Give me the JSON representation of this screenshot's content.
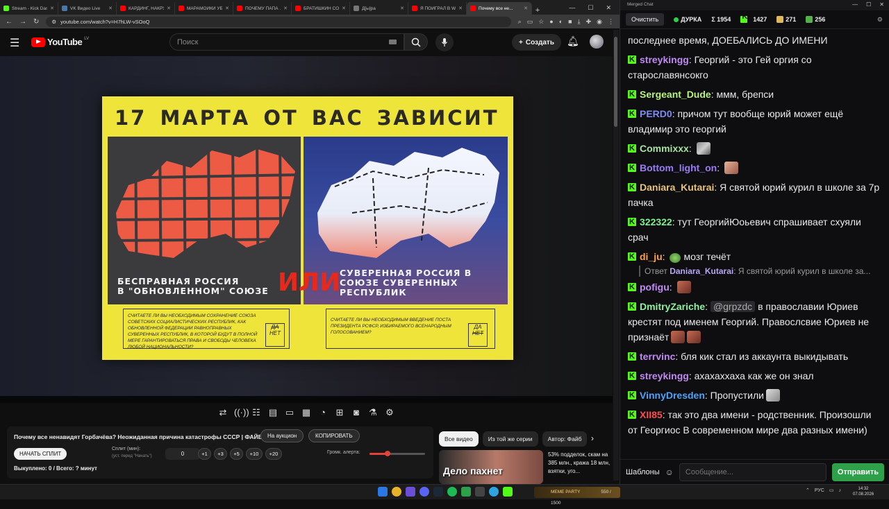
{
  "browser": {
    "tabs": [
      {
        "label": "Stream - Kick Dashboard",
        "color": "#53fc18",
        "active": false
      },
      {
        "label": "VK Видео Live",
        "color": "#4a76a8",
        "active": false
      },
      {
        "label": "КАРДИНГ, НАКРУ...",
        "color": "#ff0000",
        "active": false
      },
      {
        "label": "МАРАМОЙКИ УБ...",
        "color": "#ff0000",
        "active": false
      },
      {
        "label": "ПОЧЕМУ ПАПА ...",
        "color": "#ff0000",
        "active": false
      },
      {
        "label": "БРАТИШКИН СО...",
        "color": "#ff0000",
        "active": false
      },
      {
        "label": "Д[ы]ра",
        "color": "#777777",
        "active": false
      },
      {
        "label": "Я ПОИГРАЛ В WA...",
        "color": "#ff0000",
        "active": false
      },
      {
        "label": "Почему все не...",
        "color": "#ff0000",
        "active": true
      }
    ],
    "url": "youtube.com/watch?v=H7hLW-vSOoQ"
  },
  "youtube": {
    "logo_text": "YouTube",
    "country": "LV",
    "search_placeholder": "Поиск",
    "create_label": "Создать"
  },
  "poster": {
    "title": "17 МАРТА ОТ ВАС ЗАВИСИТ",
    "left_caption_1": "БЕСПРАВНАЯ РОССИЯ",
    "left_caption_2": "В \"ОБНОВЛЕННОМ\" СОЮЗЕ",
    "ili": "ИЛИ",
    "right_caption_1": "СУВЕРЕННАЯ РОССИЯ В",
    "right_caption_2": "СОЮЗЕ СУВЕРЕННЫХ",
    "right_caption_3": "РЕСПУБЛИК",
    "ballot_left": "СЧИТАЕТЕ ЛИ ВЫ НЕОБХОДИМЫМ СОХРАНЕНИЕ СОЮЗА СОВЕТСКИХ СОЦИАЛИСТИЧЕСКИХ РЕСПУБЛИК, КАК ОБНОВЛЕННОЙ ФЕДЕРАЦИИ РАВНОПРАВНЫХ СУВЕРЕННЫХ РЕСПУБЛИК, В КОТОРОЙ БУДУТ В ПОЛНОЙ МЕРЕ ГАРАНТИРОВАТЬСЯ ПРАВА И СВОБОДЫ ЧЕЛОВЕКА ЛЮБОЙ НАЦИОНАЛЬНОСТИ?",
    "ballot_right": "СЧИТАЕТЕ ЛИ ВЫ НЕОБХОДИМЫМ ВВЕДЕНИЕ ПОСТА ПРЕЗИДЕНТА РСФСР, ИЗБИРАЕМОГО ВСЕНАРОДНЫМ ГОЛОСОВАНИЕМ?",
    "da": "ДА",
    "net": "НЕТ",
    "left_map_color": "#ee5b45",
    "right_map_color": "#dbe6f7"
  },
  "split": {
    "video_title": "Почему все ненавидят Горбачёва? Неожиданная причина катастрофы СССР | ФАЙБ",
    "auction_label": "На аукцион",
    "copy_label": "КОПИРОВАТЬ",
    "start_label": "НАЧАТЬ СПЛИТ",
    "split_min_label": "Сплит (мин):",
    "split_min_sub": "(уст. перед \"Начать\")",
    "split_min_value": "0",
    "steps": [
      "+1",
      "+3",
      "+5",
      "+10",
      "+20"
    ],
    "volume_label": "Громк. алерта:",
    "volume_level": 0.33,
    "status": "Выкуплено: 0 / Всего: ? минут"
  },
  "chips": [
    "Все видео",
    "Из той же серии",
    "Автор: Файб"
  ],
  "recommendation": {
    "thumb_text": "Дело пахнет",
    "title": "53% подделок, скам на 385 млн., кража 18 млн, взятки, уго..."
  },
  "taskbar": {
    "meme_text": "MEME PARTY",
    "meme_progress": "550 / 1500",
    "lang": "РУС",
    "time": "14:32",
    "date": "07.08.2026"
  },
  "chat": {
    "window_title": "Merged Chat",
    "clear_label": "Очистить",
    "channel": "ДУРКА",
    "total": "Σ 1954",
    "kick_viewers": "1427",
    "other_viewers": "271",
    "vk_viewers": "256",
    "first_line": "последнее время, ДОЕБАЛИСЬ ДО ИМЕНИ",
    "messages": [
      {
        "user": "streykingg",
        "color": "#c08af5",
        "text": "Георгий - это Гей оргия со старославянсокго"
      },
      {
        "user": "Sergeant_Dude",
        "color": "#b9f27c",
        "text": "ммм, брепси"
      },
      {
        "user": "PERD0",
        "color": "#7b8cf5",
        "text": "причом тут вообще юрий может ещё владимир это георгий"
      },
      {
        "user": "Commixxx",
        "color": "#a6e3a1",
        "text": ""
      },
      {
        "user": "Bottom_light_on",
        "color": "#9b7bf5",
        "text": ""
      },
      {
        "user": "Daniara_Kutarai",
        "color": "#e8c27a",
        "text": "Я святой юрий курил в школе за 7р пачка"
      },
      {
        "user": "322322",
        "color": "#7ef08f",
        "text": "тут ГеоргийЮоьевич спрашивает схуяли срач"
      },
      {
        "user": "di_ju",
        "color": "#ff9f43",
        "text": "мозг течёт"
      },
      {
        "user": "pofigu",
        "color": "#c08af5",
        "text": ""
      },
      {
        "user": "DmitryZariche",
        "color": "#8ef0a0",
        "text": "в православии Юриев крестят под именем Георгий. Правослсвие Юриев не признаёт"
      },
      {
        "user": "terrvinc",
        "color": "#c08af5",
        "text": "бля кик стал из аккаунта выкидывать"
      },
      {
        "user": "streykingg",
        "color": "#c08af5",
        "text": "ахахаххаха как же он знал"
      },
      {
        "user": "VinnyDresden",
        "color": "#4fa3f7",
        "text": "Пропустили"
      },
      {
        "user": "XII85",
        "color": "#ff4d4d",
        "text": "так это два имени - родственник. Произошли от Георгиос В современном мире два разных имени)"
      }
    ],
    "reply_prefix": "Ответ",
    "reply_user": "Daniara_Kutarai",
    "reply_text": "Я святой юрий курил в школе за...",
    "mention": "@grpzdc",
    "templates_label": "Шаблоны",
    "input_placeholder": "Сообщение...",
    "send_label": "Отправить"
  }
}
